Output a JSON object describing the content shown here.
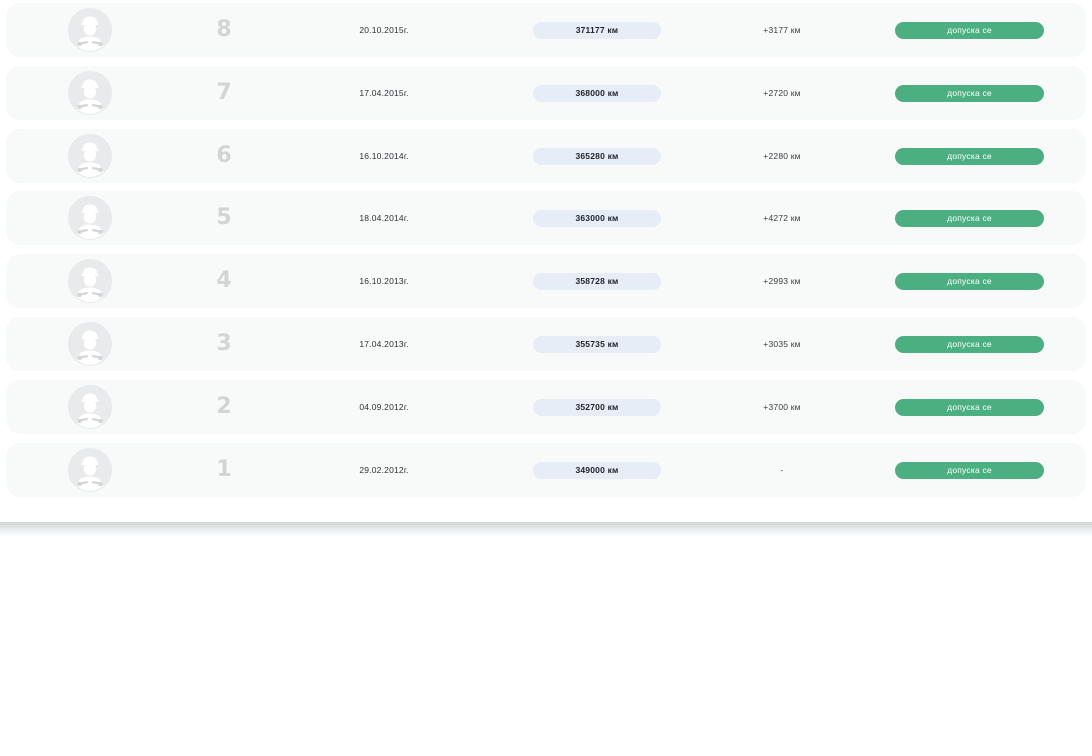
{
  "colors": {
    "row_background": "#f8f9f9",
    "mileage_pill": "#e7edf7",
    "status_green": "#4caf82",
    "number_gray": "#d2d4d6"
  },
  "icons": {
    "avatar": "mechanic-avatar-icon"
  },
  "rows": [
    {
      "num": "8",
      "date": "20.10.2015г.",
      "mileage": "371177 км",
      "diff": "+3177 км",
      "status": "допуска се"
    },
    {
      "num": "7",
      "date": "17.04.2015г.",
      "mileage": "368000 км",
      "diff": "+2720 км",
      "status": "допуска се"
    },
    {
      "num": "6",
      "date": "16.10.2014г.",
      "mileage": "365280 км",
      "diff": "+2280 км",
      "status": "допуска се"
    },
    {
      "num": "5",
      "date": "18.04.2014г.",
      "mileage": "363000 км",
      "diff": "+4272 км",
      "status": "допуска се"
    },
    {
      "num": "4",
      "date": "16.10.2013г.",
      "mileage": "358728 км",
      "diff": "+2993 км",
      "status": "допуска се"
    },
    {
      "num": "3",
      "date": "17.04.2013г.",
      "mileage": "355735 км",
      "diff": "+3035 км",
      "status": "допуска се"
    },
    {
      "num": "2",
      "date": "04.09.2012г.",
      "mileage": "352700 км",
      "diff": "+3700 км",
      "status": "допуска се"
    },
    {
      "num": "1",
      "date": "29.02.2012г.",
      "mileage": "349000 км",
      "diff": "-",
      "status": "допуска се"
    }
  ]
}
